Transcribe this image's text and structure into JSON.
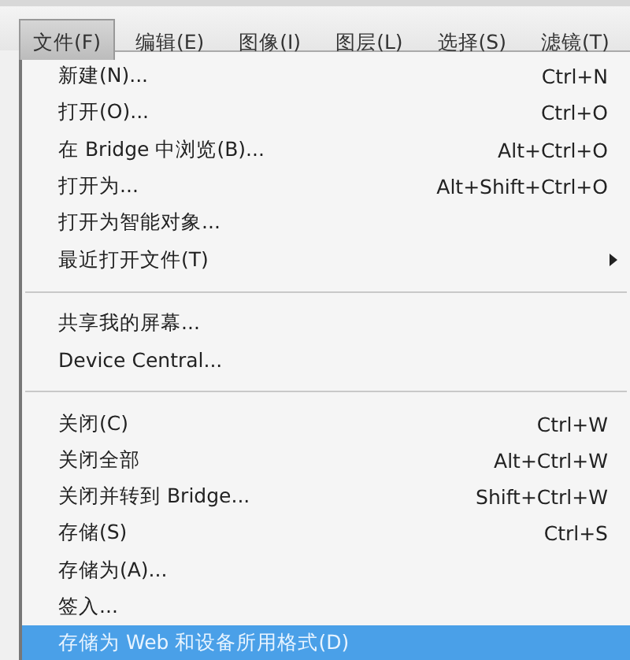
{
  "menu_bar": [
    {
      "label": "文件(F)",
      "selected": true
    },
    {
      "label": "编辑(E)",
      "selected": false
    },
    {
      "label": "图像(I)",
      "selected": false
    },
    {
      "label": "图层(L)",
      "selected": false
    },
    {
      "label": "选择(S)",
      "selected": false
    },
    {
      "label": "滤镜(T)",
      "selected": false
    }
  ],
  "menu": [
    {
      "kind": "item",
      "label": "新建(N)...",
      "shortcut": "Ctrl+N",
      "selected": false
    },
    {
      "kind": "item",
      "label": "打开(O)...",
      "shortcut": "Ctrl+O",
      "selected": false
    },
    {
      "kind": "item",
      "label": "在 Bridge 中浏览(B)...",
      "shortcut": "Alt+Ctrl+O",
      "selected": false
    },
    {
      "kind": "item",
      "label": "打开为...",
      "shortcut": "Alt+Shift+Ctrl+O",
      "selected": false
    },
    {
      "kind": "item",
      "label": "打开为智能对象...",
      "selected": false
    },
    {
      "kind": "submenu",
      "label": "最近打开文件(T)",
      "selected": false
    },
    {
      "kind": "separator"
    },
    {
      "kind": "item",
      "label": "共享我的屏幕...",
      "selected": false
    },
    {
      "kind": "item",
      "label": "Device Central...",
      "selected": false
    },
    {
      "kind": "separator"
    },
    {
      "kind": "item",
      "label": "关闭(C)",
      "shortcut": "Ctrl+W",
      "selected": false
    },
    {
      "kind": "item",
      "label": "关闭全部",
      "shortcut": "Alt+Ctrl+W",
      "selected": false
    },
    {
      "kind": "item",
      "label": "关闭并转到 Bridge...",
      "shortcut": "Shift+Ctrl+W",
      "selected": false
    },
    {
      "kind": "item",
      "label": "存储(S)",
      "shortcut": "Ctrl+S",
      "selected": false
    },
    {
      "kind": "item",
      "label": "存储为(A)...",
      "selected": false
    },
    {
      "kind": "item",
      "label": "签入...",
      "selected": false
    },
    {
      "kind": "item",
      "label": "存储为 Web 和设备所用格式(D)",
      "selected": true
    }
  ]
}
